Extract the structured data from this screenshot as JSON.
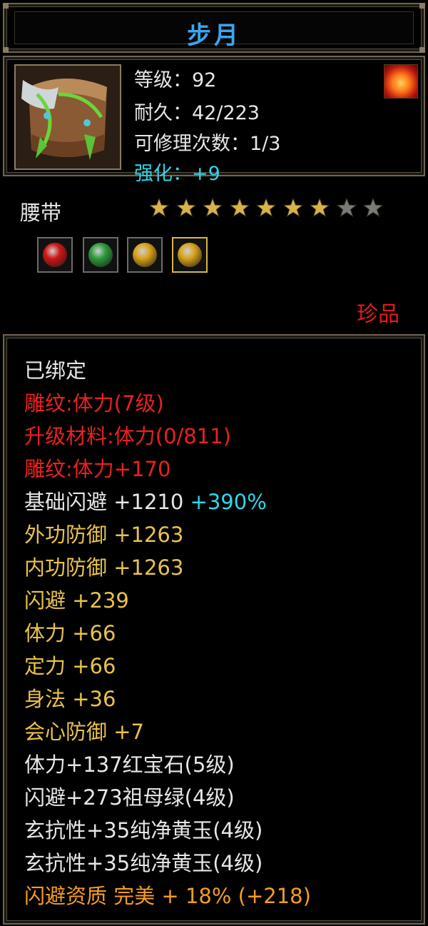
{
  "item": {
    "name": "步月",
    "level_label": "等级：92",
    "durability_label": "耐久：42/223",
    "repair_label": "可修理次数：1/3",
    "enhance_label": "强化：+9",
    "type": "腰带",
    "stars_filled": 7,
    "stars_total": 9,
    "rarity": "珍品"
  },
  "gems": [
    {
      "name": "ruby-gem",
      "color": "#d01515"
    },
    {
      "name": "emerald-gem",
      "color": "#2e9a3c"
    },
    {
      "name": "yellow-jade-gem",
      "color": "#d9a21a"
    },
    {
      "name": "yellow-jade-gem",
      "color": "#d9a21a"
    }
  ],
  "attributes": {
    "bound": "已绑定",
    "carve1": "雕纹:体力(7级)",
    "upgrade": "升级材料:体力(0/811)",
    "carve2": "雕纹:体力+170",
    "base_dodge_label": "基础闪避  +1210",
    "base_dodge_bonus": "+390%",
    "outer_def": "外功防御  +1263",
    "inner_def": "内功防御  +1263",
    "dodge": "闪避  +239",
    "stamina": "体力  +66",
    "focus": "定力  +66",
    "agility": "身法  +36",
    "crit_def": "会心防御  +7",
    "gem1": "体力+137红宝石(5级)",
    "gem2": "闪避+273祖母绿(4级)",
    "gem3": "玄抗性+35纯净黄玉(4级)",
    "gem4": "玄抗性+35纯净黄玉(4级)",
    "quality": "闪避资质  完美  + 18%  (+218)"
  },
  "colors": {
    "title": "#39a6f2",
    "enhance": "#2fd6e8",
    "rarity": "#e21b1b",
    "carve": "#ea2020",
    "stat": "#e9c24b",
    "quality": "#f59c22",
    "star_on": "#d8b24a",
    "star_off": "#7a7a7a"
  }
}
